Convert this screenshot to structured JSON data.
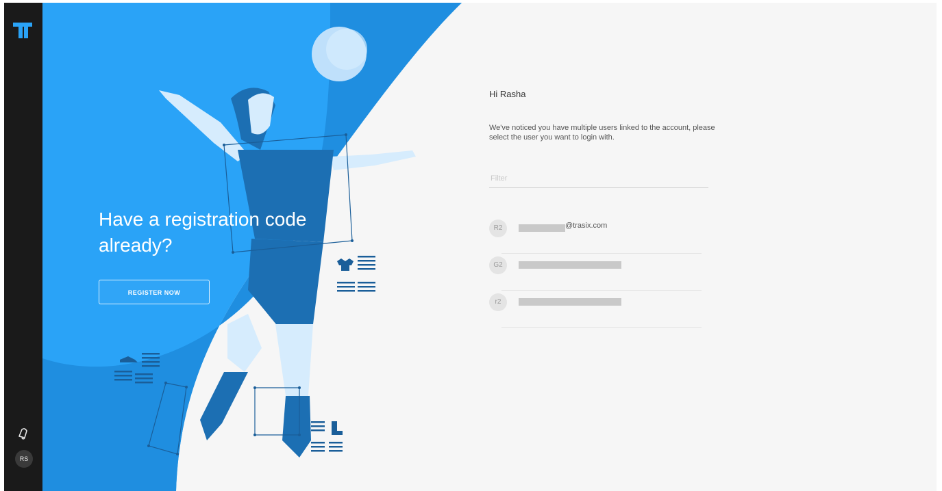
{
  "colors": {
    "rail": "#1a1a1a",
    "hero_blue": "#2aa3f7",
    "hero_blue_dark": "#1e87d6",
    "panel_bg": "#f6f6f6"
  },
  "sidebar": {
    "logo_icon": "tt-logo-icon",
    "bell_icon": "bell-icon",
    "avatar_initials": "RS"
  },
  "hero": {
    "headline": "Have a registration code already?",
    "register_label": "REGISTER NOW"
  },
  "panel": {
    "greeting": "Hi Rasha",
    "message": "We've noticed you have multiple users linked to the account, please select the user you want to login with.",
    "filter_placeholder": "Filter",
    "users": [
      {
        "initials": "R2",
        "email_suffix": "@trasix.com"
      },
      {
        "initials": "G2",
        "email_suffix": ""
      },
      {
        "initials": "r2",
        "email_suffix": ""
      }
    ]
  }
}
